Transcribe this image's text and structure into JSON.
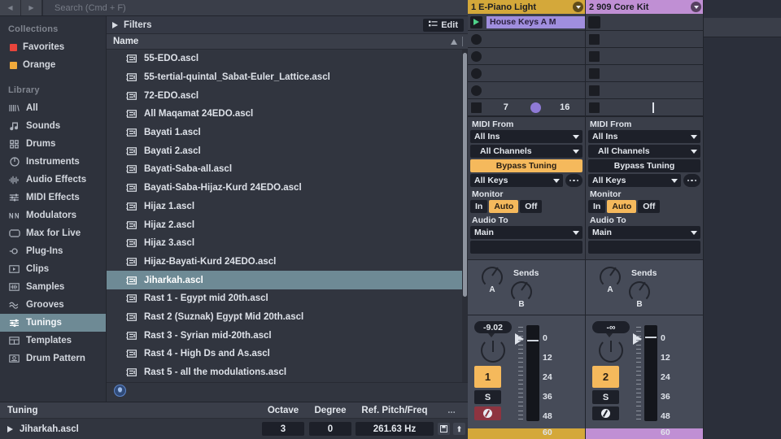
{
  "search": {
    "placeholder": "Search (Cmd + F)",
    "back_icon": "back-arrow-icon",
    "fwd_icon": "forward-arrow-icon"
  },
  "sidebar": {
    "collections_title": "Collections",
    "collections": [
      {
        "label": "Favorites",
        "color": "#e8453c"
      },
      {
        "label": "Orange",
        "color": "#f0a93b"
      }
    ],
    "library_title": "Library",
    "items": [
      {
        "label": "All",
        "icon": "all-icon",
        "selected": false
      },
      {
        "label": "Sounds",
        "icon": "note-icon",
        "selected": false
      },
      {
        "label": "Drums",
        "icon": "drums-icon",
        "selected": false
      },
      {
        "label": "Instruments",
        "icon": "instrument-icon",
        "selected": false
      },
      {
        "label": "Audio Effects",
        "icon": "waveform-icon",
        "selected": false
      },
      {
        "label": "MIDI Effects",
        "icon": "sliders-icon",
        "selected": false
      },
      {
        "label": "Modulators",
        "icon": "zigzag-icon",
        "selected": false
      },
      {
        "label": "Max for Live",
        "icon": "max-icon",
        "selected": false
      },
      {
        "label": "Plug-Ins",
        "icon": "plug-icon",
        "selected": false
      },
      {
        "label": "Clips",
        "icon": "clip-icon",
        "selected": false
      },
      {
        "label": "Samples",
        "icon": "sample-icon",
        "selected": false
      },
      {
        "label": "Grooves",
        "icon": "wave-icon",
        "selected": false
      },
      {
        "label": "Tunings",
        "icon": "tuning-icon",
        "selected": true
      },
      {
        "label": "Templates",
        "icon": "template-icon",
        "selected": false
      },
      {
        "label": "Drum Pattern",
        "icon": "pattern-icon",
        "selected": false
      }
    ]
  },
  "filters": {
    "label": "Filters",
    "edit_label": "Edit",
    "edit_icon": "list-edit-icon",
    "disclosure_icon": "triangle-right-icon"
  },
  "list": {
    "column_header": "Name",
    "sort_icon": "sort-ascending-icon",
    "files": [
      {
        "name": "55-EDO.ascl",
        "selected": false
      },
      {
        "name": "55-tertial-quintal_Sabat-Euler_Lattice.ascl",
        "selected": false
      },
      {
        "name": "72-EDO.ascl",
        "selected": false
      },
      {
        "name": "All Maqamat 24EDO.ascl",
        "selected": false
      },
      {
        "name": "Bayati 1.ascl",
        "selected": false
      },
      {
        "name": "Bayati 2.ascl",
        "selected": false
      },
      {
        "name": "Bayati-Saba-all.ascl",
        "selected": false
      },
      {
        "name": "Bayati-Saba-Hijaz-Kurd 24EDO.ascl",
        "selected": false
      },
      {
        "name": "Hijaz 1.ascl",
        "selected": false
      },
      {
        "name": "Hijaz 2.ascl",
        "selected": false
      },
      {
        "name": "Hijaz 3.ascl",
        "selected": false
      },
      {
        "name": "Hijaz-Bayati-Kurd 24EDO.ascl",
        "selected": false
      },
      {
        "name": "Jiharkah.ascl",
        "selected": true
      },
      {
        "name": "Rast 1 - Egypt mid 20th.ascl",
        "selected": false
      },
      {
        "name": "Rast 2 (Suznak) Egypt Mid 20th.ascl",
        "selected": false
      },
      {
        "name": "Rast 3 - Syrian mid-20th.ascl",
        "selected": false
      },
      {
        "name": "Rast 4 - High Ds and As.ascl",
        "selected": false
      },
      {
        "name": "Rast 5 - all the modulations.ascl",
        "selected": false
      }
    ],
    "footer_icon": "globe-icon"
  },
  "tuning_bar": {
    "columns": {
      "tuning": "Tuning",
      "octave": "Octave",
      "degree": "Degree",
      "ref": "Ref. Pitch/Freq",
      "more": "..."
    },
    "row": {
      "name": "Jiharkah.ascl",
      "play_icon": "triangle-right-icon",
      "octave": "3",
      "degree": "0",
      "ref_pitch": "261.63 Hz",
      "save_icon": "floppy-save-icon",
      "export_icon": "export-icon"
    }
  },
  "tracks": [
    {
      "name": "1 E-Piano Light",
      "color": "#d4a83a",
      "clip": {
        "name": "House Keys A M",
        "color": "#a08ede",
        "playing": true
      },
      "scene_value": "7",
      "midi_from_label": "MIDI From",
      "midi_from": "All Ins",
      "midi_channel": "All Channels",
      "bypass_tuning": {
        "label": "Bypass Tuning",
        "active": true
      },
      "keys": "All Keys",
      "monitor_label": "Monitor",
      "monitor": {
        "in": "In",
        "auto": "Auto",
        "off": "Off",
        "selected": "Auto"
      },
      "audio_to_label": "Audio To",
      "audio_to": "Main",
      "sends_label": "Sends",
      "send_a": "A",
      "send_b": "B",
      "volume": "-9.02",
      "track_number": "1",
      "solo": "S",
      "record_armed": true
    },
    {
      "name": "2 909 Core Kit",
      "color": "#c08fd4",
      "clip": null,
      "scene_value": "16",
      "midi_from_label": "MIDI From",
      "midi_from": "All Ins",
      "midi_channel": "All Channels",
      "bypass_tuning": {
        "label": "Bypass Tuning",
        "active": false
      },
      "keys": "All Keys",
      "monitor_label": "Monitor",
      "monitor": {
        "in": "In",
        "auto": "Auto",
        "off": "Off",
        "selected": "Auto"
      },
      "audio_to_label": "Audio To",
      "audio_to": "Main",
      "sends_label": "Sends",
      "send_a": "A",
      "send_b": "B",
      "volume": "-∞",
      "track_number": "2",
      "solo": "S",
      "record_armed": false
    }
  ],
  "meter_scale": [
    "0",
    "12",
    "24",
    "36",
    "48",
    "60"
  ]
}
